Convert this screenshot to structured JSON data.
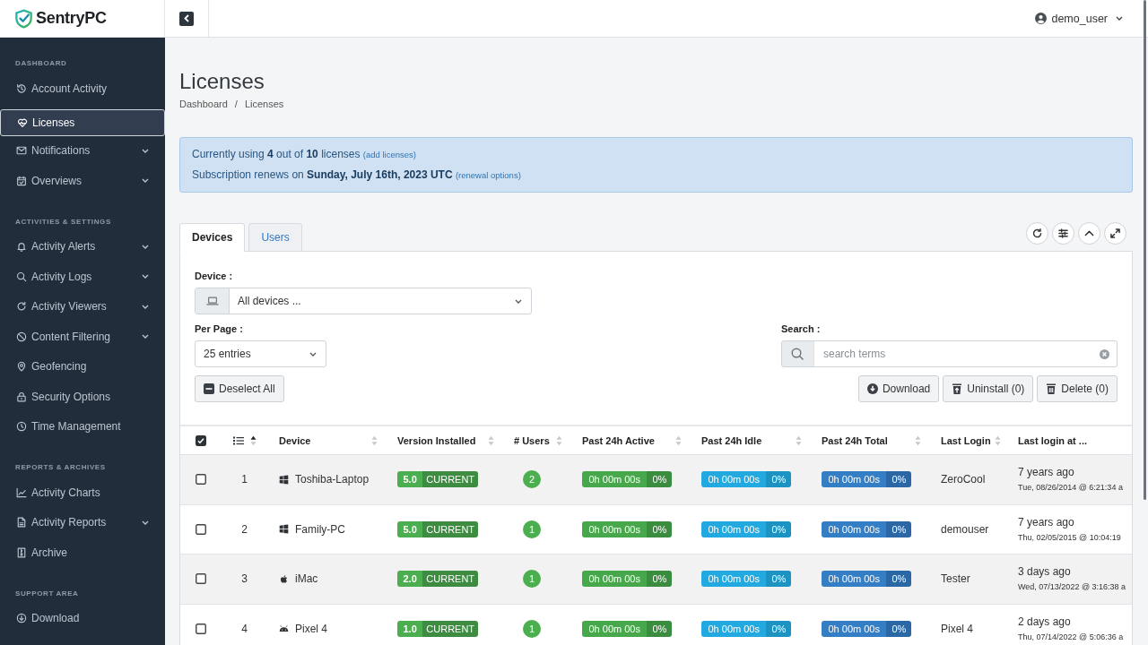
{
  "brand": {
    "name": "SentryPC"
  },
  "sidebar": {
    "sections": [
      {
        "heading": "DASHBOARD",
        "items": [
          {
            "label": "Account Activity",
            "selected": false,
            "expandable": false
          },
          {
            "label": "Licenses",
            "selected": true,
            "expandable": false
          },
          {
            "label": "Notifications",
            "selected": false,
            "expandable": true
          },
          {
            "label": "Overviews",
            "selected": false,
            "expandable": true
          }
        ]
      },
      {
        "heading": "ACTIVITIES & SETTINGS",
        "items": [
          {
            "label": "Activity Alerts",
            "selected": false,
            "expandable": true
          },
          {
            "label": "Activity Logs",
            "selected": false,
            "expandable": true
          },
          {
            "label": "Activity Viewers",
            "selected": false,
            "expandable": true
          },
          {
            "label": "Content Filtering",
            "selected": false,
            "expandable": true
          },
          {
            "label": "Geofencing",
            "selected": false,
            "expandable": false
          },
          {
            "label": "Security Options",
            "selected": false,
            "expandable": false
          },
          {
            "label": "Time Management",
            "selected": false,
            "expandable": false
          }
        ]
      },
      {
        "heading": "REPORTS & ARCHIVES",
        "items": [
          {
            "label": "Activity Charts",
            "selected": false,
            "expandable": false
          },
          {
            "label": "Activity Reports",
            "selected": false,
            "expandable": true
          },
          {
            "label": "Archive",
            "selected": false,
            "expandable": false
          }
        ]
      },
      {
        "heading": "SUPPORT AREA",
        "items": [
          {
            "label": "Download",
            "selected": false,
            "expandable": false
          }
        ]
      }
    ]
  },
  "topbar": {
    "user": "demo_user"
  },
  "page": {
    "title": "Licenses",
    "breadcrumb": {
      "items": [
        "Dashboard",
        "Licenses"
      ],
      "separator": "/"
    }
  },
  "alert": {
    "lines": [
      {
        "text": "Currently using **4** out of **10** licenses",
        "link": "(add licenses)"
      },
      {
        "text": "Subscription renews on **Sunday, July 16th, 2023 UTC**",
        "link": "(renewal options)"
      }
    ]
  },
  "tabs": [
    {
      "label": "Devices",
      "selected": true
    },
    {
      "label": "Users",
      "selected": false
    }
  ],
  "filters": {
    "device": {
      "label": "Device :",
      "value": "All devices ..."
    },
    "per_page": {
      "label": "Per Page :",
      "value": "25 entries"
    },
    "search": {
      "label": "Search :",
      "placeholder": "search terms"
    }
  },
  "actions": {
    "left": [
      "Deselect All"
    ],
    "right": [
      "Download",
      "Uninstall (0)",
      "Delete (0)"
    ]
  },
  "table": {
    "columns": [
      {
        "kind": "checkbox",
        "checked": true
      },
      {
        "kind": "index",
        "sortable": true,
        "sorted": true
      },
      {
        "kind": "text",
        "label": "Device",
        "sortable": true,
        "sorted": false
      },
      {
        "kind": "text",
        "label": "Version Installed",
        "sortable": true,
        "sorted": false
      },
      {
        "kind": "text",
        "label": "# Users",
        "sortable": true,
        "sorted": false
      },
      {
        "kind": "text",
        "label": "Past 24h Active",
        "sortable": true,
        "sorted": false
      },
      {
        "kind": "text",
        "label": "Past 24h Idle",
        "sortable": true,
        "sorted": false
      },
      {
        "kind": "text",
        "label": "Past 24h Total",
        "sortable": true,
        "sorted": false
      },
      {
        "kind": "text",
        "label": "Last Login",
        "sortable": true,
        "sorted": false
      },
      {
        "kind": "text",
        "label": "Last login at ...",
        "sortable": false
      }
    ],
    "rows": [
      {
        "checked": false,
        "number": "1",
        "kind": "windows",
        "device": "Toshiba-Laptop",
        "version": {
          "number": "5.0",
          "status": "CURRENT"
        },
        "users": "2",
        "active": {
          "time": "0h 00m 00s",
          "percent": "0%"
        },
        "idle": {
          "time": "0h 00m 00s",
          "percent": "0%"
        },
        "total": {
          "time": "0h 00m 00s",
          "percent": "0%"
        },
        "last_login": "ZeroCool",
        "last_login_ago": "7 years ago",
        "last_login_at": "Tue, 08/26/2014 @ 6:21:34 a"
      },
      {
        "checked": false,
        "number": "2",
        "kind": "windows",
        "device": "Family-PC",
        "version": {
          "number": "5.0",
          "status": "CURRENT"
        },
        "users": "1",
        "active": {
          "time": "0h 00m 00s",
          "percent": "0%"
        },
        "idle": {
          "time": "0h 00m 00s",
          "percent": "0%"
        },
        "total": {
          "time": "0h 00m 00s",
          "percent": "0%"
        },
        "last_login": "demouser",
        "last_login_ago": "7 years ago",
        "last_login_at": "Thu, 02/05/2015 @ 10:04:19"
      },
      {
        "checked": false,
        "number": "3",
        "kind": "apple",
        "device": "iMac",
        "version": {
          "number": "2.0",
          "status": "CURRENT"
        },
        "users": "1",
        "active": {
          "time": "0h 00m 00s",
          "percent": "0%"
        },
        "idle": {
          "time": "0h 00m 00s",
          "percent": "0%"
        },
        "total": {
          "time": "0h 00m 00s",
          "percent": "0%"
        },
        "last_login": "Tester",
        "last_login_ago": "3 days ago",
        "last_login_at": "Wed, 07/13/2022 @ 3:16:38 a"
      },
      {
        "checked": false,
        "number": "4",
        "kind": "android",
        "device": "Pixel 4",
        "version": {
          "number": "1.0",
          "status": "CURRENT"
        },
        "users": "1",
        "active": {
          "time": "0h 00m 00s",
          "percent": "0%"
        },
        "idle": {
          "time": "0h 00m 00s",
          "percent": "0%"
        },
        "total": {
          "time": "0h 00m 00s",
          "percent": "0%"
        },
        "last_login": "Pixel 4",
        "last_login_ago": "2 days ago",
        "last_login_at": "Thu, 07/14/2022 @ 5:06:36 a"
      }
    ]
  }
}
